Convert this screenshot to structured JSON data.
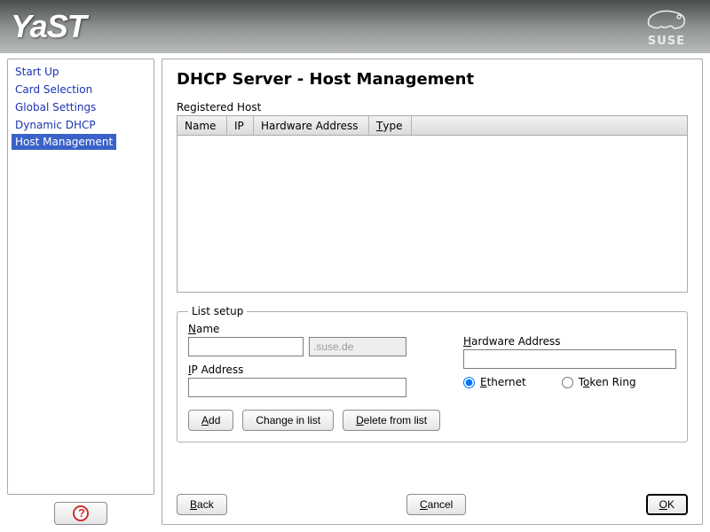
{
  "header": {
    "app_name": "YaST",
    "brand": "SUSE"
  },
  "sidebar": {
    "items": [
      {
        "label": "Start Up",
        "selected": false
      },
      {
        "label": "Card Selection",
        "selected": false
      },
      {
        "label": "Global Settings",
        "selected": false
      },
      {
        "label": "Dynamic DHCP",
        "selected": false
      },
      {
        "label": "Host Management",
        "selected": true
      }
    ]
  },
  "main": {
    "title": "DHCP Server - Host Management",
    "registered_host_label": "Registered Host",
    "columns": {
      "name": "Name",
      "ip": "IP",
      "hw": "Hardware Address",
      "type": "Type"
    },
    "list_setup": {
      "legend": "List setup",
      "name_label": "Name",
      "name_value": "",
      "domain_suffix": ".suse.de",
      "ip_label": "IP Address",
      "ip_value": "",
      "hw_label": "Hardware Address",
      "hw_value": "",
      "radio_ethernet": "Ethernet",
      "radio_tokenring": "Token Ring",
      "hw_type": "ethernet",
      "btn_add": "Add",
      "btn_change": "Change in list",
      "btn_delete": "Delete from list"
    },
    "buttons": {
      "back": "Back",
      "cancel": "Cancel",
      "ok": "OK"
    }
  }
}
